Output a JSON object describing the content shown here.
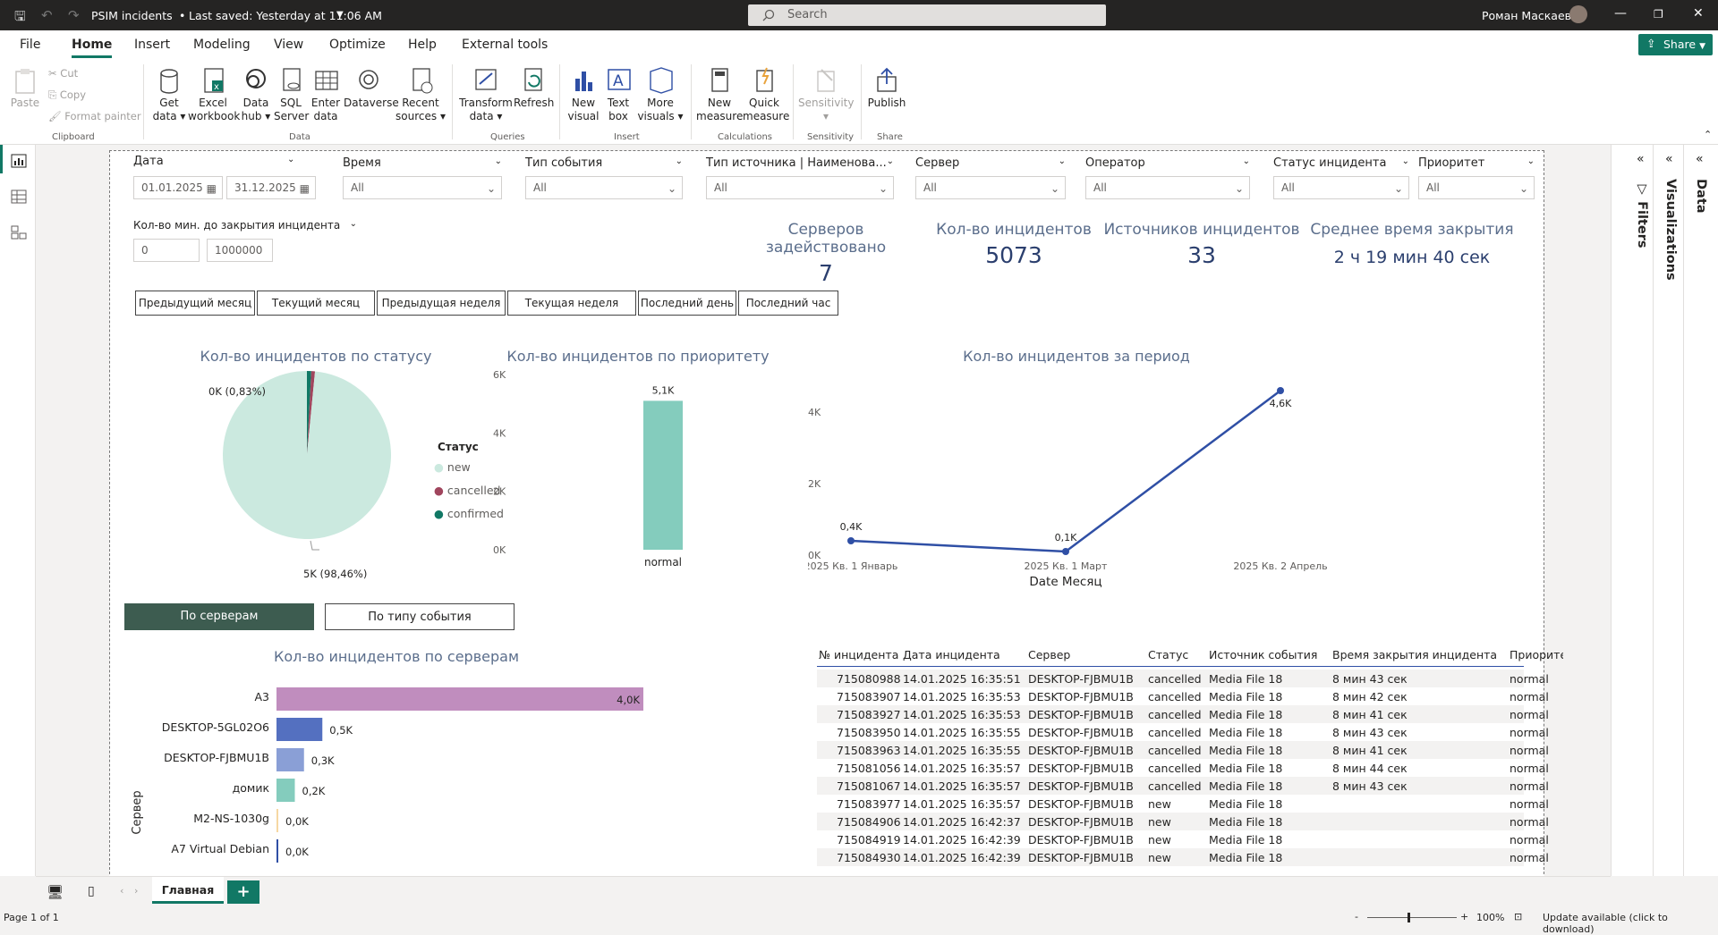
{
  "titlebar": {
    "title": "PSIM incidents",
    "saved": "Last saved: Yesterday at 11:06 AM",
    "search_placeholder": "Search",
    "user": "Роман Маскаев"
  },
  "menu": {
    "file": "File",
    "home": "Home",
    "insert": "Insert",
    "modeling": "Modeling",
    "view": "View",
    "optimize": "Optimize",
    "help": "Help",
    "external": "External tools",
    "share": "Share"
  },
  "ribbon": {
    "clipboard": {
      "paste": "Paste",
      "cut": "Cut",
      "copy": "Copy",
      "format_painter": "Format painter",
      "group": "Clipboard"
    },
    "data": {
      "get_data": [
        "Get",
        "data"
      ],
      "excel": [
        "Excel",
        "workbook"
      ],
      "data_hub": [
        "Data",
        "hub"
      ],
      "sql": [
        "SQL",
        "Server"
      ],
      "enter": [
        "Enter",
        "data"
      ],
      "dataverse": "Dataverse",
      "recent": [
        "Recent",
        "sources"
      ],
      "group": "Data"
    },
    "queries": {
      "transform": [
        "Transform",
        "data"
      ],
      "refresh": "Refresh",
      "group": "Queries"
    },
    "insert": {
      "new_visual": [
        "New",
        "visual"
      ],
      "text_box": [
        "Text",
        "box"
      ],
      "more_visuals": [
        "More",
        "visuals"
      ],
      "group": "Insert"
    },
    "calc": {
      "new_measure": [
        "New",
        "measure"
      ],
      "quick_measure": [
        "Quick",
        "measure"
      ],
      "group": "Calculations"
    },
    "sensitivity": {
      "label": "Sensitivity",
      "group": "Sensitivity"
    },
    "share": {
      "publish": "Publish",
      "group": "Share"
    }
  },
  "panes": {
    "filters": "Filters",
    "visualizations": "Visualizations",
    "data": "Data"
  },
  "slicers": {
    "date": {
      "label": "Дата",
      "from": "01.01.2025",
      "to": "31.12.2025"
    },
    "time": {
      "label": "Время",
      "value": "All"
    },
    "event_type": {
      "label": "Тип события",
      "value": "All"
    },
    "source_type": {
      "label": "Тип источника | Наименова...",
      "value": "All"
    },
    "server": {
      "label": "Сервер",
      "value": "All"
    },
    "operator": {
      "label": "Оператор",
      "value": "All"
    },
    "status": {
      "label": "Статус инцидента",
      "value": "All"
    },
    "priority": {
      "label": "Приоритет",
      "value": "All"
    },
    "minutes": {
      "label": "Кол-во мин. до закрытия инцидента",
      "from": "0",
      "to": "1000000"
    }
  },
  "kpis": [
    {
      "label": "Серверов задействовано",
      "value": "7"
    },
    {
      "label": "Кол-во инцидентов",
      "value": "5073"
    },
    {
      "label": "Источников инцидентов",
      "value": "33"
    },
    {
      "label": "Среднее время закрытия",
      "value": "2 ч 19 мин 40 сек"
    }
  ],
  "period_buttons": [
    "Предыдущий месяц",
    "Текущий месяц",
    "Предыдущая неделя",
    "Текущая неделя",
    "Последний день",
    "Последний час"
  ],
  "toggles": {
    "by_server": "По серверам",
    "by_event": "По типу события"
  },
  "colors": {
    "accent": "#117865",
    "navy": "#2b3f6e",
    "pie_new": "#cbe9df",
    "pie_cancelled": "#a0455d",
    "pie_confirmed": "#117865",
    "teal": "#84ccbd",
    "line": "#2f4fa5"
  },
  "chart_data": [
    {
      "type": "pie",
      "title": "Кол-во инцидентов по статусу",
      "legend_title": "Статус",
      "slices": [
        {
          "name": "new",
          "value": 98.46,
          "label": "5K (98,46%)",
          "color": "#cbe9df"
        },
        {
          "name": "cancelled",
          "value": 0.71,
          "color": "#a0455d"
        },
        {
          "name": "confirmed",
          "value": 0.83,
          "label": "0K (0,83%)",
          "color": "#117865"
        }
      ]
    },
    {
      "type": "bar",
      "title": "Кол-во инцидентов по приоритету",
      "categories": [
        "normal"
      ],
      "values": [
        5100
      ],
      "labels": [
        "5,1K"
      ],
      "yticks": [
        "0K",
        "2K",
        "4K",
        "6K"
      ],
      "ylim": [
        0,
        6000
      ]
    },
    {
      "type": "line",
      "title": "Кол-во инцидентов за период",
      "xlabel": "Date Месяц",
      "categories": [
        "2025 Кв. 1 Январь",
        "2025 Кв. 1 Март",
        "2025 Кв. 2 Апрель"
      ],
      "values": [
        400,
        100,
        4600
      ],
      "labels": [
        "0,4K",
        "0,1K",
        "4,6K"
      ],
      "yticks": [
        "0K",
        "2K",
        "4K"
      ],
      "ylim": [
        0,
        4800
      ]
    },
    {
      "type": "bar",
      "orientation": "horizontal",
      "title": "Кол-во инцидентов по серверам",
      "ylabel": "Сервер",
      "categories": [
        "A3",
        "DESKTOP-5GL02O6",
        "DESKTOP-FJBMU1B",
        "домик",
        "M2-NS-1030g",
        "A7 Virtual Debian"
      ],
      "values": [
        4000,
        500,
        300,
        200,
        0,
        0
      ],
      "labels": [
        "4,0K",
        "0,5K",
        "0,3K",
        "0,2K",
        "0,0K",
        "0,0K"
      ],
      "colors": [
        "#c08dbe",
        "#5470c0",
        "#8a9fd6",
        "#84ccbd",
        "#f6d8a3",
        "#2f4fa5"
      ]
    }
  ],
  "table": {
    "columns": [
      "№ инцидента",
      "Дата инцидента",
      "Сервер",
      "Статус",
      "Источник события",
      "Время закрытия инцидента",
      "Приоритет"
    ],
    "rows": [
      [
        "715080988",
        "14.01.2025 16:35:51",
        "DESKTOP-FJBMU1B",
        "cancelled",
        "Media File 18",
        "8 мин 43 сек",
        "normal"
      ],
      [
        "715083907",
        "14.01.2025 16:35:53",
        "DESKTOP-FJBMU1B",
        "cancelled",
        "Media File 18",
        "8 мин 42 сек",
        "normal"
      ],
      [
        "715083927",
        "14.01.2025 16:35:53",
        "DESKTOP-FJBMU1B",
        "cancelled",
        "Media File 18",
        "8 мин 41 сек",
        "normal"
      ],
      [
        "715083950",
        "14.01.2025 16:35:55",
        "DESKTOP-FJBMU1B",
        "cancelled",
        "Media File 18",
        "8 мин 43 сек",
        "normal"
      ],
      [
        "715083963",
        "14.01.2025 16:35:55",
        "DESKTOP-FJBMU1B",
        "cancelled",
        "Media File 18",
        "8 мин 41 сек",
        "normal"
      ],
      [
        "715081056",
        "14.01.2025 16:35:57",
        "DESKTOP-FJBMU1B",
        "cancelled",
        "Media File 18",
        "8 мин 44 сек",
        "normal"
      ],
      [
        "715081067",
        "14.01.2025 16:35:57",
        "DESKTOP-FJBMU1B",
        "cancelled",
        "Media File 18",
        "8 мин 43 сек",
        "normal"
      ],
      [
        "715083977",
        "14.01.2025 16:35:57",
        "DESKTOP-FJBMU1B",
        "new",
        "Media File 18",
        "",
        "normal"
      ],
      [
        "715084906",
        "14.01.2025 16:42:37",
        "DESKTOP-FJBMU1B",
        "new",
        "Media File 18",
        "",
        "normal"
      ],
      [
        "715084919",
        "14.01.2025 16:42:39",
        "DESKTOP-FJBMU1B",
        "new",
        "Media File 18",
        "",
        "normal"
      ],
      [
        "715084930",
        "14.01.2025 16:42:39",
        "DESKTOP-FJBMU1B",
        "new",
        "Media File 18",
        "",
        "normal"
      ]
    ]
  },
  "tabs": {
    "page": "Главная",
    "add": "+"
  },
  "status": {
    "page": "Page 1 of 1",
    "zoom": "100%",
    "update": "Update available (click to download)"
  }
}
